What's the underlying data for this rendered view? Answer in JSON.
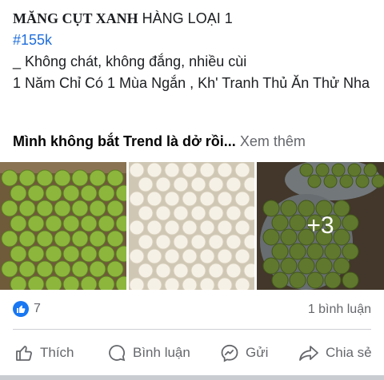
{
  "post": {
    "title_bold": "MĂNG CỤT XANH",
    "title_rest": " HÀNG LOẠI 1",
    "price_tag": "#155k",
    "line_1": "_ Không chát, không đắng, nhiều cùi",
    "line_2": "1 Năm Chỉ Có 1 Mùa Ngắn , Kh' Tranh Thủ Ăn Thử Nha",
    "headline": "Mình không bắt Trend là dở rồi",
    "ellipsis": "...",
    "see_more": "Xem thêm"
  },
  "photos": {
    "more_count": "+3"
  },
  "stats": {
    "like_count": "7",
    "comment_count": "1 bình luận"
  },
  "actions": {
    "like": "Thích",
    "comment": "Bình luận",
    "send": "Gửi",
    "share": "Chia sẻ"
  },
  "colors": {
    "accent_blue": "#1877f2",
    "hashtag_blue": "#216fdb",
    "muted_text": "#65676b"
  }
}
